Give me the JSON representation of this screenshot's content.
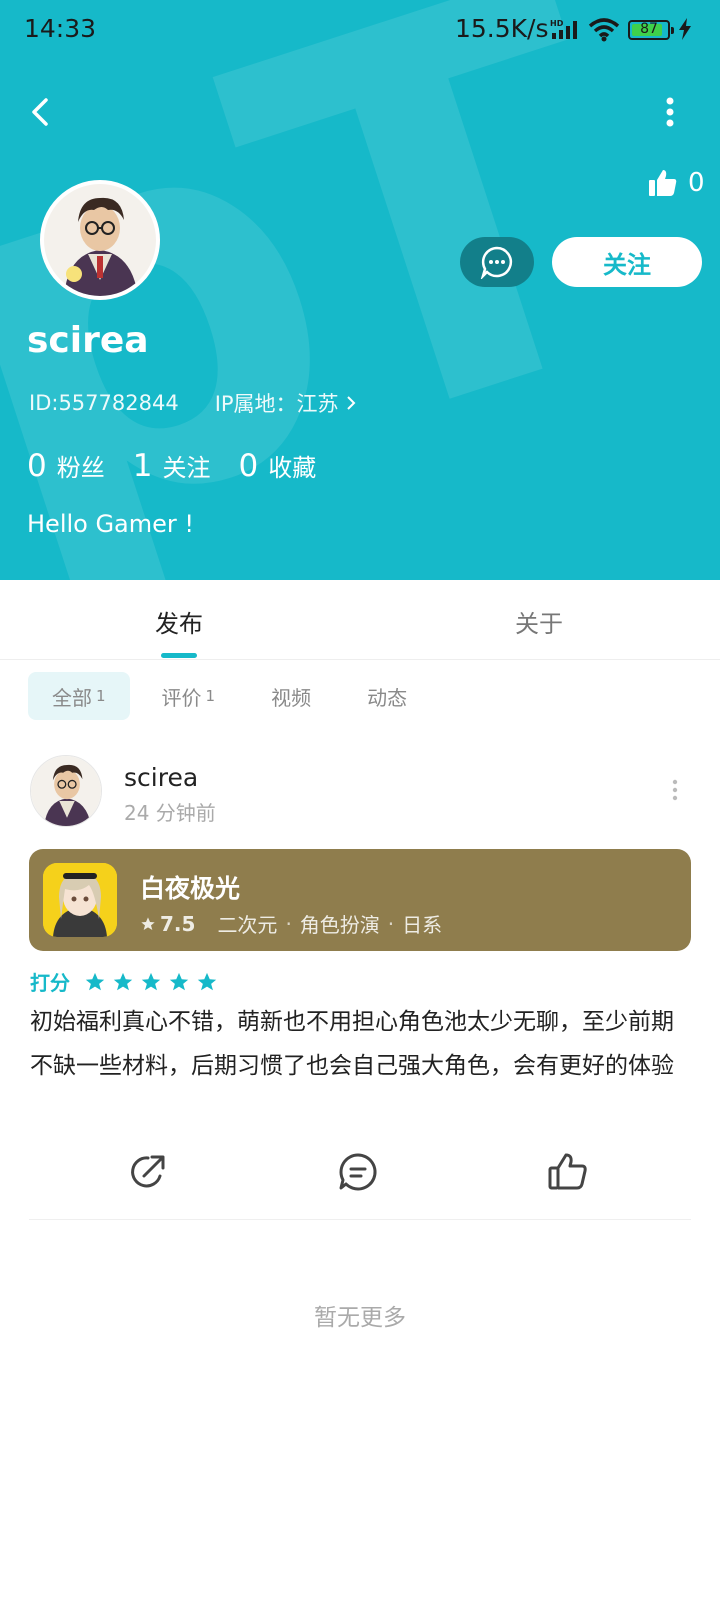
{
  "status_bar": {
    "time": "14:33",
    "net_speed": "15.5K/s",
    "battery": "87",
    "battery_level": 0.87,
    "icons": [
      "hd-signal-icon",
      "wifi-icon",
      "battery-icon",
      "charging-icon"
    ]
  },
  "header": {
    "bg_color": "#16b9c9",
    "like_count": "0",
    "follow_label": "关注",
    "username": "scirea",
    "user_id": "ID:557782844",
    "ip_location": "IP属地：江苏",
    "stats": [
      {
        "num": "0",
        "label": "粉丝"
      },
      {
        "num": "1",
        "label": "关注"
      },
      {
        "num": "0",
        "label": "收藏"
      }
    ],
    "bio": "Hello Gamer !"
  },
  "tabs": {
    "active": "发布",
    "inactive": "关于"
  },
  "filters": [
    {
      "label": "全部",
      "count": "1",
      "active": true
    },
    {
      "label": "评价",
      "count": "1",
      "active": false
    },
    {
      "label": "视频",
      "count": "",
      "active": false
    },
    {
      "label": "动态",
      "count": "",
      "active": false
    }
  ],
  "post": {
    "author": "scirea",
    "time": "24 分钟前",
    "game": {
      "title": "白夜极光",
      "score": "7.5",
      "tags": [
        "二次元",
        "角色扮演",
        "日系"
      ],
      "card_color": "#8f7d4d"
    },
    "rating_label": "打分",
    "stars": 5,
    "body": "初始福利真心不错，萌新也不用担心角色池太少无聊，至少前期不缺一些材料，后期习惯了也会自己强大角色，会有更好的体验"
  },
  "footer": {
    "no_more": "暂无更多"
  },
  "accent_color": "#16b9c9"
}
